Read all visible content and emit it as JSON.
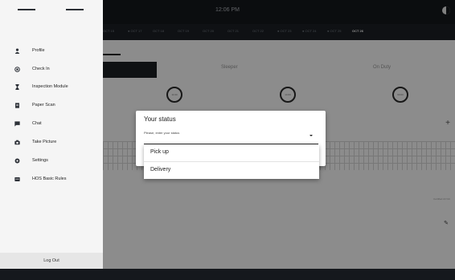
{
  "topbar": {
    "time": "12:06 PM"
  },
  "dates": [
    {
      "label": "OCT 15",
      "flag": false,
      "active": false
    },
    {
      "label": "OCT 17",
      "flag": true,
      "active": false
    },
    {
      "label": "OCT 18",
      "flag": false,
      "active": false
    },
    {
      "label": "OCT 19",
      "flag": false,
      "active": false
    },
    {
      "label": "OCT 20",
      "flag": false,
      "active": false
    },
    {
      "label": "OCT 21",
      "flag": false,
      "active": false
    },
    {
      "label": "OCT 22",
      "flag": false,
      "active": false
    },
    {
      "label": "OCT 23",
      "flag": true,
      "active": false
    },
    {
      "label": "OCT 24",
      "flag": true,
      "active": false
    },
    {
      "label": "OCT 25",
      "flag": true,
      "active": false
    },
    {
      "label": "OCT 26",
      "flag": false,
      "active": true
    }
  ],
  "statuses": [
    {
      "label": "Sleeper"
    },
    {
      "label": "On Duty"
    }
  ],
  "timers": [
    {
      "value": "11:00"
    },
    {
      "value": "14:00"
    },
    {
      "value": "60:00"
    }
  ],
  "footer_meta": "Certified 22 Oct",
  "drawer": {
    "items": [
      {
        "label": "Profile",
        "icon": "person-icon"
      },
      {
        "label": "Check In",
        "icon": "location-icon"
      },
      {
        "label": "Inspection Module",
        "icon": "hourglass-icon"
      },
      {
        "label": "Paper Scan",
        "icon": "document-icon"
      },
      {
        "label": "Chat",
        "icon": "chat-icon"
      },
      {
        "label": "Take Picture",
        "icon": "camera-icon"
      },
      {
        "label": "Settings",
        "icon": "gear-icon"
      },
      {
        "label": "HOS Basic Rules",
        "icon": "card-icon"
      }
    ],
    "logout": "Log Out"
  },
  "dialog": {
    "title": "Your status",
    "field_label": "Please, enter your status",
    "options": [
      "Pick up",
      "Delivery"
    ]
  },
  "colors": {
    "topbar": "#15181d",
    "drawer_bg": "#f5f5f5",
    "active_date": "#ffffff",
    "scrim": "rgba(0,0,0,0.45)"
  }
}
